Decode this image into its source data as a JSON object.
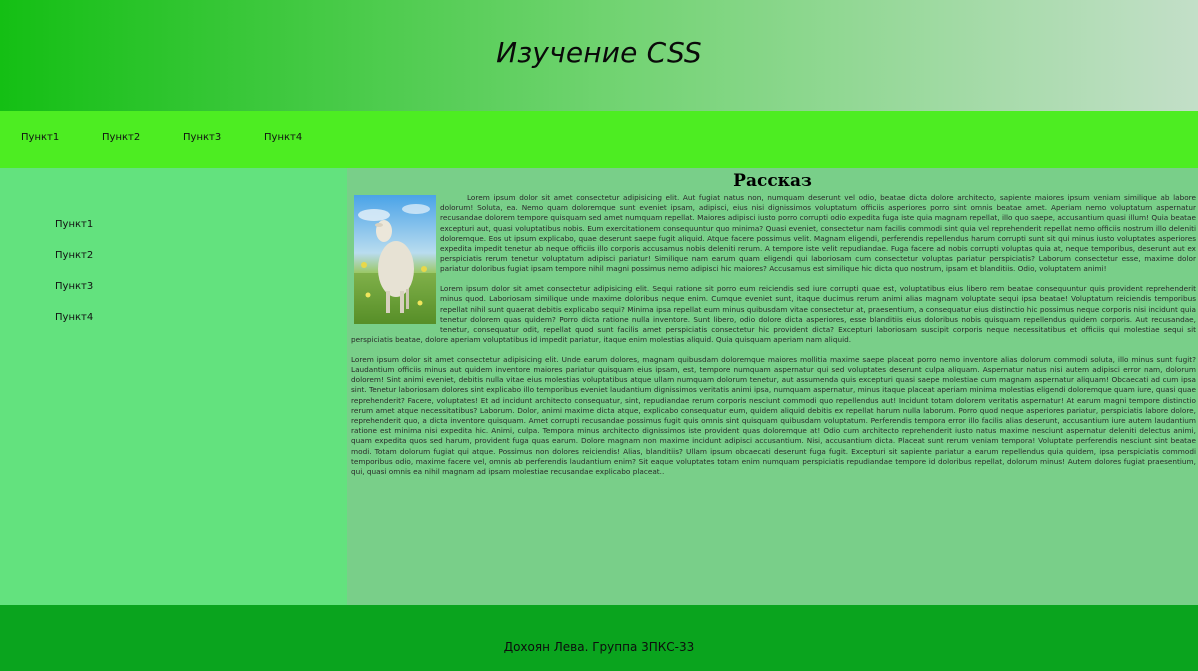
{
  "header": {
    "title": "Изучение CSS"
  },
  "topnav": {
    "items": [
      "Пункт1",
      "Пункт2",
      "Пункт3",
      "Пункт4"
    ]
  },
  "sidebar": {
    "items": [
      "Пункт1",
      "Пункт2",
      "Пункт3",
      "Пункт4"
    ]
  },
  "article": {
    "title": "Рассказ",
    "image": "goat-photo",
    "paragraphs": [
      "Lorem ipsum dolor sit amet consectetur adipisicing elit. Aut fugiat natus non, numquam deserunt vel odio, beatae dicta dolore architecto, sapiente maiores ipsum veniam similique ab labore dolorum! Soluta, ea. Nemo quam doloremque sunt eveniet ipsam, adipisci, eius nisi dignissimos voluptatum officiis asperiores porro sint omnis beatae amet. Aperiam nemo voluptatum aspernatur recusandae dolorem tempore quisquam sed amet numquam repellat. Maiores adipisci iusto porro corrupti odio expedita fuga iste quia magnam repellat, illo quo saepe, accusantium quasi illum! Quia beatae excepturi aut, quasi voluptatibus nobis. Eum exercitationem consequuntur quo minima? Quasi eveniet, consectetur nam facilis commodi sint quia vel reprehenderit repellat nemo officiis nostrum illo deleniti doloremque. Eos ut ipsum explicabo, quae deserunt saepe fugit aliquid. Atque facere possimus velit. Magnam eligendi, perferendis repellendus harum corrupti sunt sit qui minus iusto voluptates asperiores expedita impedit tenetur ab neque officiis illo corporis accusamus nobis deleniti rerum. A tempore iste velit repudiandae. Fuga facere ad nobis corrupti voluptas quia at, neque temporibus, deserunt aut ex perspiciatis rerum tenetur voluptatum adipisci pariatur! Similique nam earum quam eligendi qui laboriosam cum consectetur voluptas pariatur perspiciatis? Laborum consectetur esse, maxime dolor pariatur doloribus fugiat ipsam tempore nihil magni possimus nemo adipisci hic maiores? Accusamus est similique hic dicta quo nostrum, ipsam et blanditiis. Odio, voluptatem animi!",
      "Lorem ipsum dolor sit amet consectetur adipisicing elit. Sequi ratione sit porro eum reiciendis sed iure corrupti quae est, voluptatibus eius libero rem beatae consequuntur quis provident reprehenderit minus quod. Laboriosam similique unde maxime doloribus neque enim. Cumque eveniet sunt, itaque ducimus rerum animi alias magnam voluptate sequi ipsa beatae! Voluptatum reiciendis temporibus repellat nihil sunt quaerat debitis explicabo sequi? Minima ipsa repellat eum minus quibusdam vitae consectetur at, praesentium, a consequatur eius distinctio hic possimus neque corporis nisi incidunt quia tenetur dolorem quas quidem? Porro dicta ratione nulla inventore. Sunt libero, odio dolore dicta asperiores, esse blanditiis eius doloribus nobis quisquam repellendus quidem corporis. Aut recusandae, tenetur, consequatur odit, repellat quod sunt facilis amet perspiciatis consectetur hic provident dicta? Excepturi laboriosam suscipit corporis neque necessitatibus et officiis qui molestiae sequi sit perspiciatis beatae, dolore aperiam voluptatibus id impedit pariatur, itaque enim molestias aliquid. Quia quisquam aperiam nam aliquid.",
      "Lorem ipsum dolor sit amet consectetur adipisicing elit. Unde earum dolores, magnam quibusdam doloremque maiores mollitia maxime saepe placeat porro nemo inventore alias dolorum commodi soluta, illo minus sunt fugit? Laudantium officiis minus aut quidem inventore maiores pariatur quisquam eius ipsam, est, tempore numquam aspernatur qui sed voluptates deserunt culpa aliquam. Aspernatur natus nisi autem adipisci error nam, dolorum dolorem! Sint animi eveniet, debitis nulla vitae eius molestias voluptatibus atque ullam numquam dolorum tenetur, aut assumenda quis excepturi quasi saepe molestiae cum magnam aspernatur aliquam! Obcaecati ad cum ipsa sint. Tenetur laboriosam dolores sint explicabo illo temporibus eveniet laudantium dignissimos veritatis animi ipsa, numquam aspernatur, minus itaque placeat aperiam minima molestias eligendi doloremque quam iure, quasi quae reprehenderit? Facere, voluptates! Et ad incidunt architecto consequatur, sint, repudiandae rerum corporis nesciunt commodi quo repellendus aut! Incidunt totam dolorem veritatis aspernatur! At earum magni tempore distinctio rerum amet atque necessitatibus? Laborum. Dolor, animi maxime dicta atque, explicabo consequatur eum, quidem aliquid debitis ex repellat harum nulla laborum. Porro quod neque asperiores pariatur, perspiciatis labore dolore, reprehenderit quo, a dicta inventore quisquam. Amet corrupti recusandae possimus fugit quis omnis sint quisquam quibusdam voluptatum. Perferendis tempora error illo facilis alias deserunt, accusantium iure autem laudantium ratione est minima nisi expedita hic. Animi, culpa. Tempora minus architecto dignissimos iste provident quas doloremque at! Odio cum architecto reprehenderit iusto natus maxime nesciunt aspernatur deleniti delectus animi, quam expedita quos sed harum, provident fuga quas earum. Dolore magnam non maxime incidunt adipisci accusantium. Nisi, accusantium dicta. Placeat sunt rerum veniam tempora! Voluptate perferendis nesciunt sint beatae modi. Totam dolorum fugiat qui atque. Possimus non dolores reiciendis! Alias, blanditiis? Ullam ipsum obcaecati deserunt fuga fugit. Excepturi sit sapiente pariatur a earum repellendus quia quidem, ipsa perspiciatis commodi temporibus odio, maxime facere vel, omnis ab perferendis laudantium enim? Sit eaque voluptates totam enim numquam perspiciatis repudiandae tempore id doloribus repellat, dolorum minus! Autem dolores fugiat praesentium, qui, quasi omnis ea nihil magnam ad ipsam molestiae recusandae explicabo placeat.."
    ]
  },
  "footer": {
    "text": "Дохоян Лева. Группа 3ПКС-33"
  },
  "colors": {
    "header_start": "#14bf14",
    "header_end": "#c3dfc8",
    "topnav": "#4ded22",
    "sidebar": "#63e27e",
    "content": "#79cf89",
    "footer": "#0aa41e"
  }
}
